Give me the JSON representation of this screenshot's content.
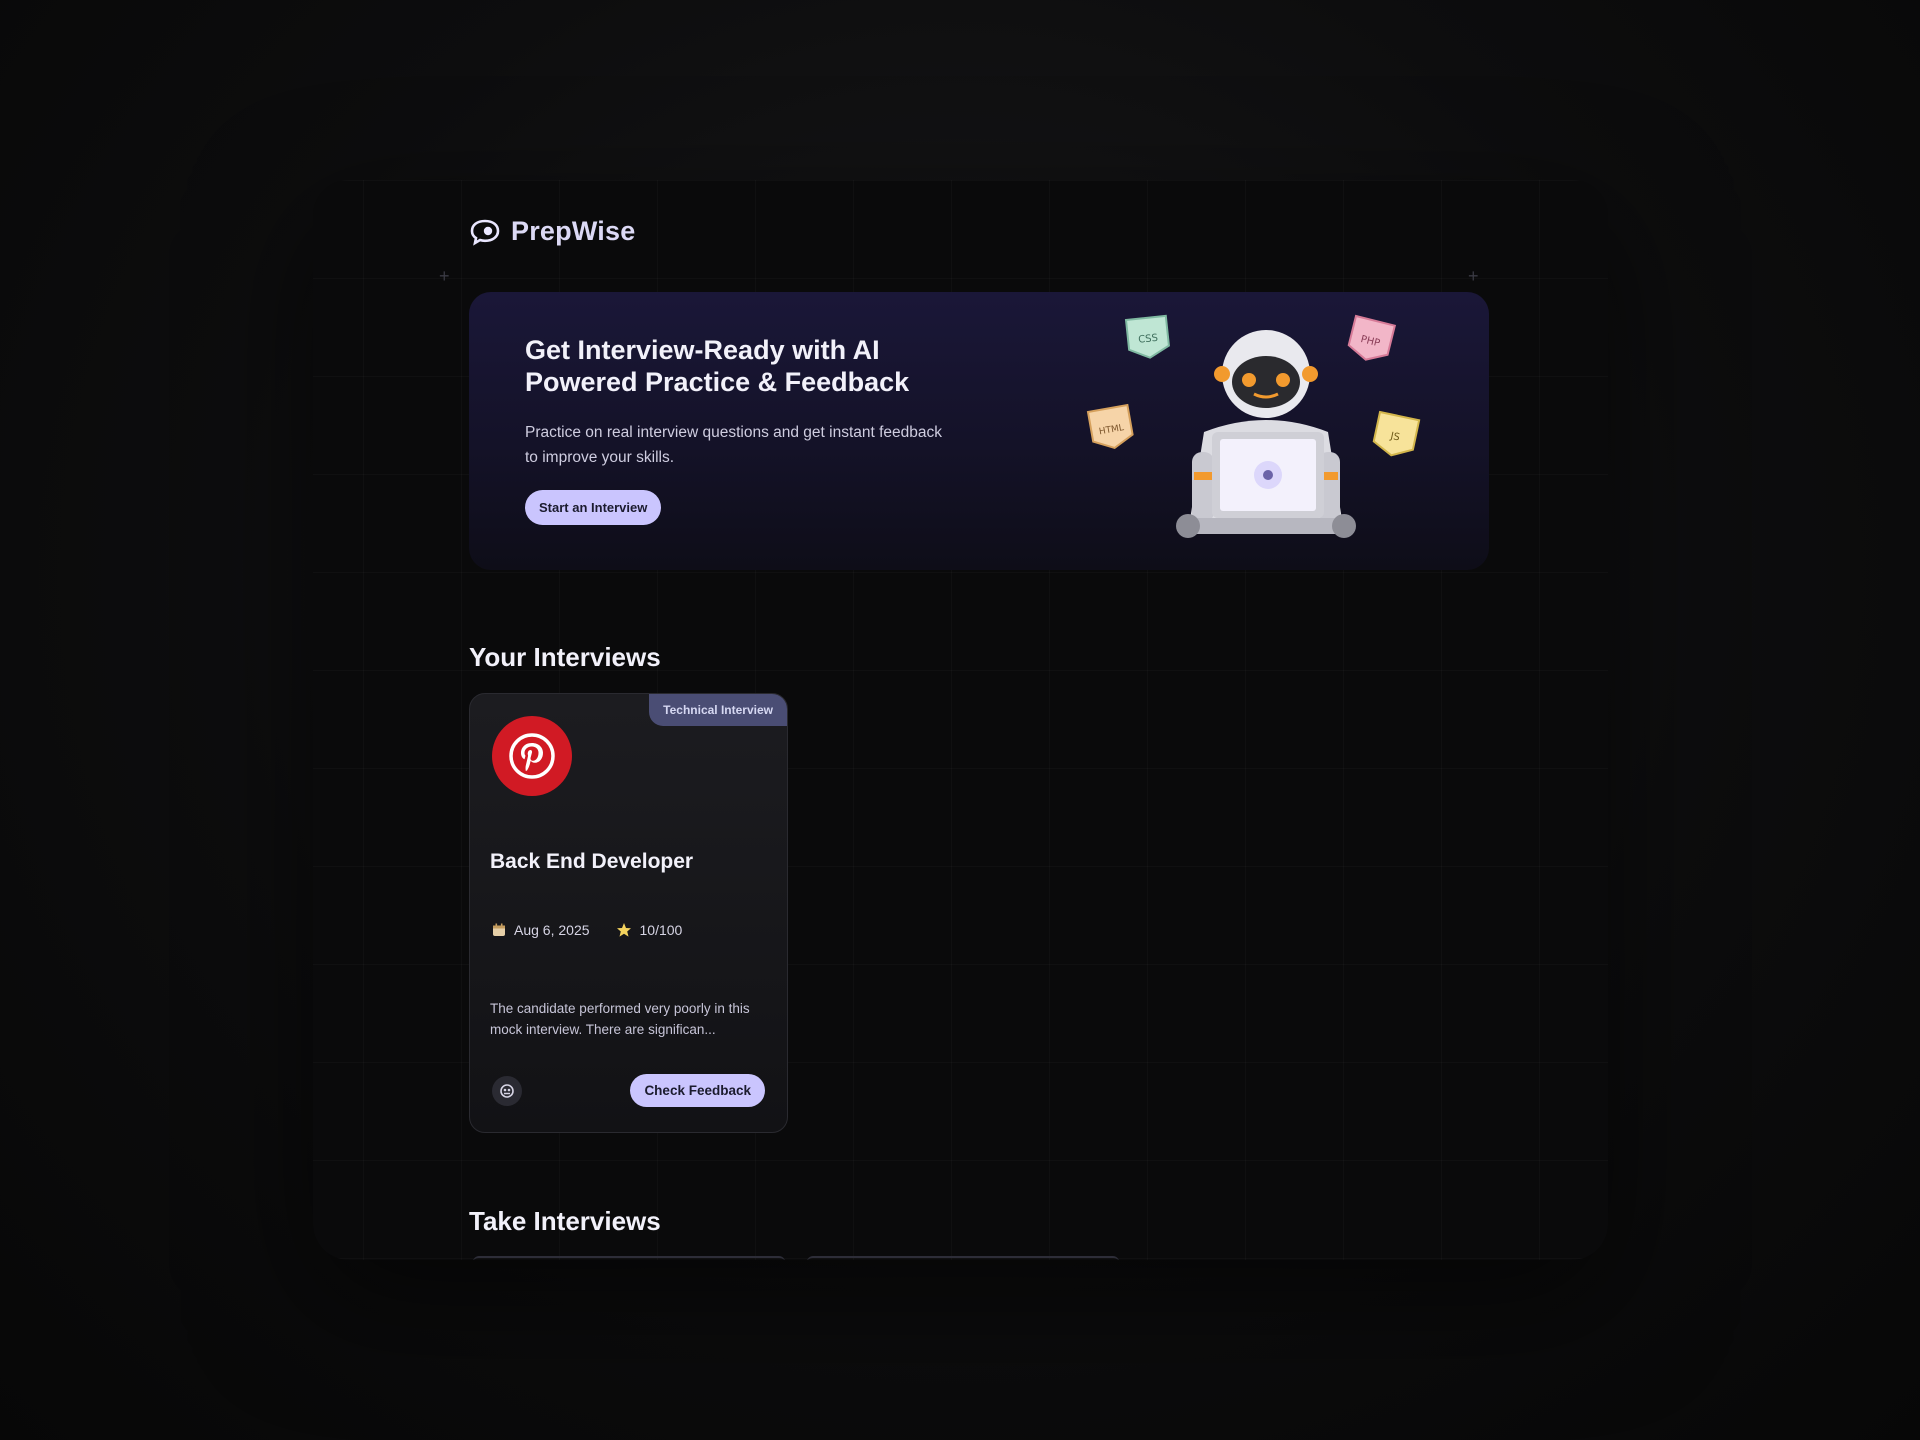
{
  "brand": {
    "name": "PrepWise"
  },
  "hero": {
    "title_line1": "Get Interview-Ready with AI",
    "title_line2": "Powered Practice & Feedback",
    "subtitle_line1": "Practice on real interview questions and get instant feedback",
    "subtitle_line2": "to improve your skills.",
    "cta_label": "Start an Interview",
    "tags": [
      "CSS",
      "PHP",
      "HTML",
      "JS"
    ]
  },
  "your_interviews": {
    "title": "Your Interviews",
    "cards": [
      {
        "badge": "Technical Interview",
        "company_icon": "pinterest-logo",
        "role": "Back End Developer",
        "date": "Aug 6, 2025",
        "score": "10/100",
        "description": "The candidate performed very poorly in this mock interview. There are significan...",
        "tech_icon": "tech-stack-icon",
        "action_label": "Check Feedback"
      }
    ]
  },
  "take_interviews": {
    "title": "Take Interviews"
  },
  "colors": {
    "accent": "#cac5fe",
    "badge": "#4a4d74",
    "pinterest": "#d11a24",
    "star": "#f4d35e"
  }
}
